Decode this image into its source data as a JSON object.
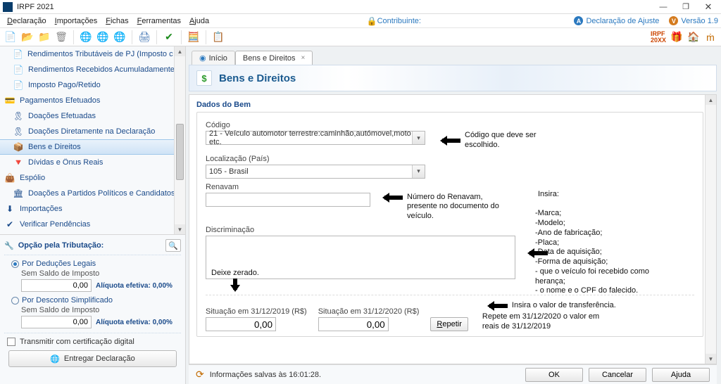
{
  "app": {
    "title": "IRPF 2021"
  },
  "menu": {
    "items": [
      "Declaração",
      "Importações",
      "Fichas",
      "Ferramentas",
      "Ajuda"
    ],
    "contribuinte_label": "Contribuinte:",
    "decl_ajuste": "Declaração de Ajuste",
    "versao": "Versão 1.9"
  },
  "sidebar": {
    "items": [
      {
        "label": "Rendimentos Tributáveis de PJ (Imposto com Exigibilidade Suspensa)",
        "group": false,
        "sel": false,
        "icon": "📄"
      },
      {
        "label": "Rendimentos Recebidos Acumuladamente",
        "group": false,
        "sel": false,
        "icon": "📄"
      },
      {
        "label": "Imposto Pago/Retido",
        "group": false,
        "sel": false,
        "icon": "📄"
      },
      {
        "label": "Pagamentos Efetuados",
        "group": true,
        "sel": false,
        "icon": "💳"
      },
      {
        "label": "Doações Efetuadas",
        "group": false,
        "sel": false,
        "icon": "🎗"
      },
      {
        "label": "Doações Diretamente na Declaração",
        "group": false,
        "sel": false,
        "icon": "🎗"
      },
      {
        "label": "Bens e Direitos",
        "group": false,
        "sel": true,
        "icon": "📦"
      },
      {
        "label": "Dívidas e Ônus Reais",
        "group": false,
        "sel": false,
        "icon": "🔻"
      },
      {
        "label": "Espólio",
        "group": true,
        "sel": false,
        "icon": "👜"
      },
      {
        "label": "Doações a Partidos Políticos e Candidatos",
        "group": false,
        "sel": false,
        "icon": "🏛"
      },
      {
        "label": "Importações",
        "group": true,
        "sel": false,
        "icon": "⬇"
      },
      {
        "label": "Verificar Pendências",
        "group": true,
        "sel": false,
        "icon": "✔"
      }
    ],
    "opt_title": "Opção pela Tributação:",
    "opt1": "Por Deduções Legais",
    "opt2": "Por Desconto Simplificado",
    "sem_saldo": "Sem Saldo de Imposto",
    "valor": "0,00",
    "aliq": "Alíquota efetiva: 0,00%",
    "transmitir": "Transmitir com certificação digital",
    "entregar": "Entregar Declaração"
  },
  "tabs": {
    "t1": "Início",
    "t2": "Bens e Direitos"
  },
  "header": {
    "title": "Bens e Direitos"
  },
  "form": {
    "fieldset_title": "Dados do Bem",
    "codigo_label": "Código",
    "codigo_value": "21 - Veículo automotor terrestre:caminhão,autómovel,moto etc.",
    "local_label": "Localização (País)",
    "local_value": "105 - Brasil",
    "renavam_label": "Renavam",
    "discr_label": "Discriminação",
    "situ1_label": "Situação em 31/12/2019 (R$)",
    "situ2_label": "Situação em 31/12/2020 (R$)",
    "situ_value": "0,00",
    "repetir": "Repetir",
    "annot_codigo": "Código que deve ser escolhido.",
    "annot_renavam": "Número do Renavam, presente no documento do veículo.",
    "annot_insira_head": "Insira:",
    "annot_insira_body": "-Marca;\n-Modelo;\n-Ano de fabricação;\n-Placa;\n-Data de aquisição;\n-Forma de aquisição;\n- que o veículo foi recebido como herança;\n- o nome e o CPF do falecido.",
    "annot_zerado": "Deixe zerado.",
    "annot_transf": "Insira o valor de transferência.",
    "annot_repetir": "Repete em 31/12/2020 o valor em reais de 31/12/2019"
  },
  "footer": {
    "info": "Informações salvas às 16:01:28.",
    "ok": "OK",
    "cancel": "Cancelar",
    "help": "Ajuda"
  }
}
